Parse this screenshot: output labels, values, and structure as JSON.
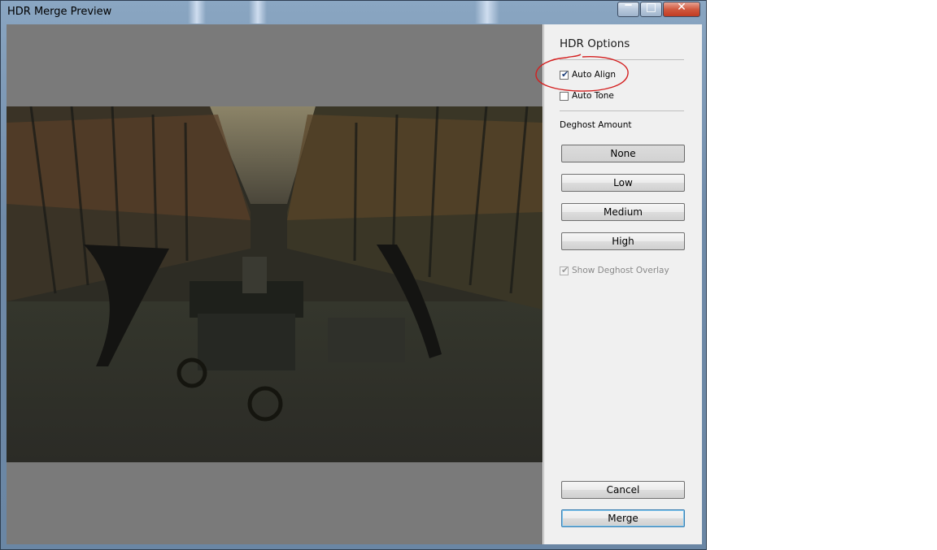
{
  "window": {
    "title": "HDR Merge Preview",
    "controls": {
      "minimize": "‒",
      "maximize": "□",
      "close": "✕"
    }
  },
  "options": {
    "heading": "HDR Options",
    "auto_align": {
      "label": "Auto Align",
      "checked": true
    },
    "auto_tone": {
      "label": "Auto Tone",
      "checked": false
    },
    "deghost": {
      "label": "Deghost Amount",
      "buttons": [
        "None",
        "Low",
        "Medium",
        "High"
      ],
      "selected": "None"
    },
    "show_overlay": {
      "label": "Show Deghost Overlay",
      "checked": true,
      "enabled": false
    }
  },
  "actions": {
    "cancel": "Cancel",
    "merge": "Merge"
  },
  "colors": {
    "annotation": "#d42020",
    "default_button_border": "#3c7fb1"
  }
}
